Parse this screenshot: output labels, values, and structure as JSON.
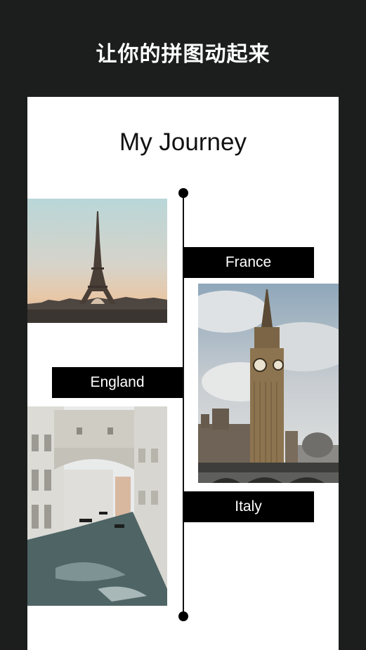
{
  "header": {
    "title": "让你的拼图动起来"
  },
  "card": {
    "title": "My Journey",
    "labels": {
      "france": "France",
      "england": "England",
      "italy": "Italy"
    }
  },
  "colors": {
    "background": "#1b1e1d",
    "card": "#ffffff",
    "label_bg": "#000000",
    "label_text": "#ffffff"
  }
}
